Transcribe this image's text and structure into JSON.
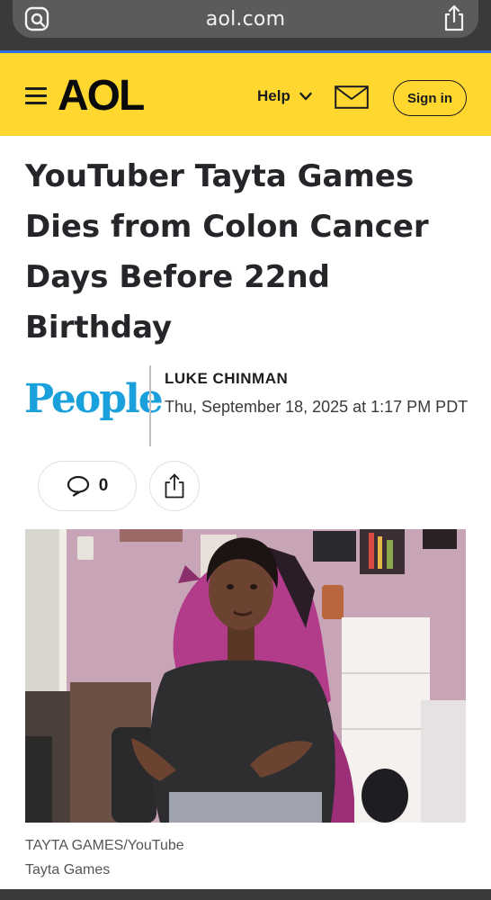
{
  "browser": {
    "url": "aol.com",
    "site_settings_icon": "site-settings-icon",
    "share_icon": "share-icon"
  },
  "header": {
    "logo": "AOL",
    "help_label": "Help",
    "mail_icon": "mail-icon",
    "signin_label": "Sign in",
    "brand_color": "#ffd72e"
  },
  "article": {
    "headline": "YouTuber Tayta Games Dies from Colon Cancer Days Before 22nd Birthday",
    "source_logo": "People",
    "source_color": "#1aa0db",
    "author": "LUKE CHINMAN",
    "published": "Thu, September 18, 2025 at 1:17 PM PDT",
    "comment_count": "0",
    "photo_credit": "TAYTA GAMES/YouTube",
    "photo_caption": "Tayta Games"
  }
}
